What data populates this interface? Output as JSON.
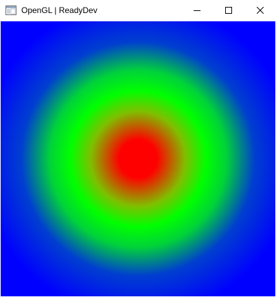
{
  "window": {
    "title": "OpenGL | ReadyDev"
  },
  "titlebar": {
    "app_icon": "window-icon",
    "minimize_icon": "minimize-icon",
    "maximize_icon": "maximize-icon",
    "close_icon": "close-icon"
  },
  "canvas": {
    "background_color": "#0000ff",
    "center_color": "#ff0000",
    "ring_color": "#00ff00",
    "outer_color": "#0000ff"
  }
}
